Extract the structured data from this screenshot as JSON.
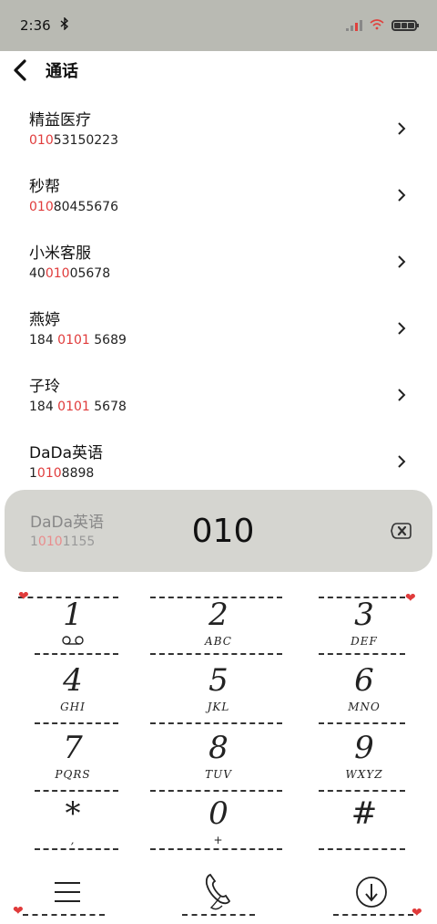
{
  "status_bar": {
    "time": "2:36",
    "bluetooth_icon": "bluetooth-icon",
    "colors": {
      "bar": "#b9bab3",
      "signal_accent": "#e0413d"
    }
  },
  "header": {
    "title": "通话",
    "back_icon": "chevron-left-icon"
  },
  "contacts": [
    {
      "name": "精益医疗",
      "pre": "",
      "match": "010",
      "post": "53150223"
    },
    {
      "name": "秒帮",
      "pre": "",
      "match": "010",
      "post": "80455676"
    },
    {
      "name": "小米客服",
      "pre": "40",
      "match": "010",
      "post": "05678"
    },
    {
      "name": "燕婷",
      "pre": "184 ",
      "match": "0101",
      "post": " 5689"
    },
    {
      "name": "子玲",
      "pre": "184 ",
      "match": "0101",
      "post": " 5678"
    },
    {
      "name": "DaDa英语",
      "pre": "1",
      "match": "010",
      "post": "8898"
    }
  ],
  "dial": {
    "suggestion": {
      "name": "DaDa英语",
      "pre": "1",
      "match": "010",
      "post": "1155"
    },
    "digits": "010",
    "backspace_icon": "backspace-icon"
  },
  "keys": [
    {
      "digit": "1",
      "letters": ""
    },
    {
      "digit": "2",
      "letters": "ABC"
    },
    {
      "digit": "3",
      "letters": "DEF"
    },
    {
      "digit": "4",
      "letters": "GHI"
    },
    {
      "digit": "5",
      "letters": "JKL"
    },
    {
      "digit": "6",
      "letters": "MNO"
    },
    {
      "digit": "7",
      "letters": "PQRS"
    },
    {
      "digit": "8",
      "letters": "TUV"
    },
    {
      "digit": "9",
      "letters": "WXYZ"
    },
    {
      "digit": "*",
      "letters": ","
    },
    {
      "digit": "0",
      "letters": "+"
    },
    {
      "digit": "#",
      "letters": ""
    }
  ],
  "bottom_bar": {
    "menu_icon": "menu-icon",
    "call_icon": "phone-icon",
    "collapse_icon": "arrow-down-circle-icon"
  },
  "accent_color": "#e03b3b"
}
